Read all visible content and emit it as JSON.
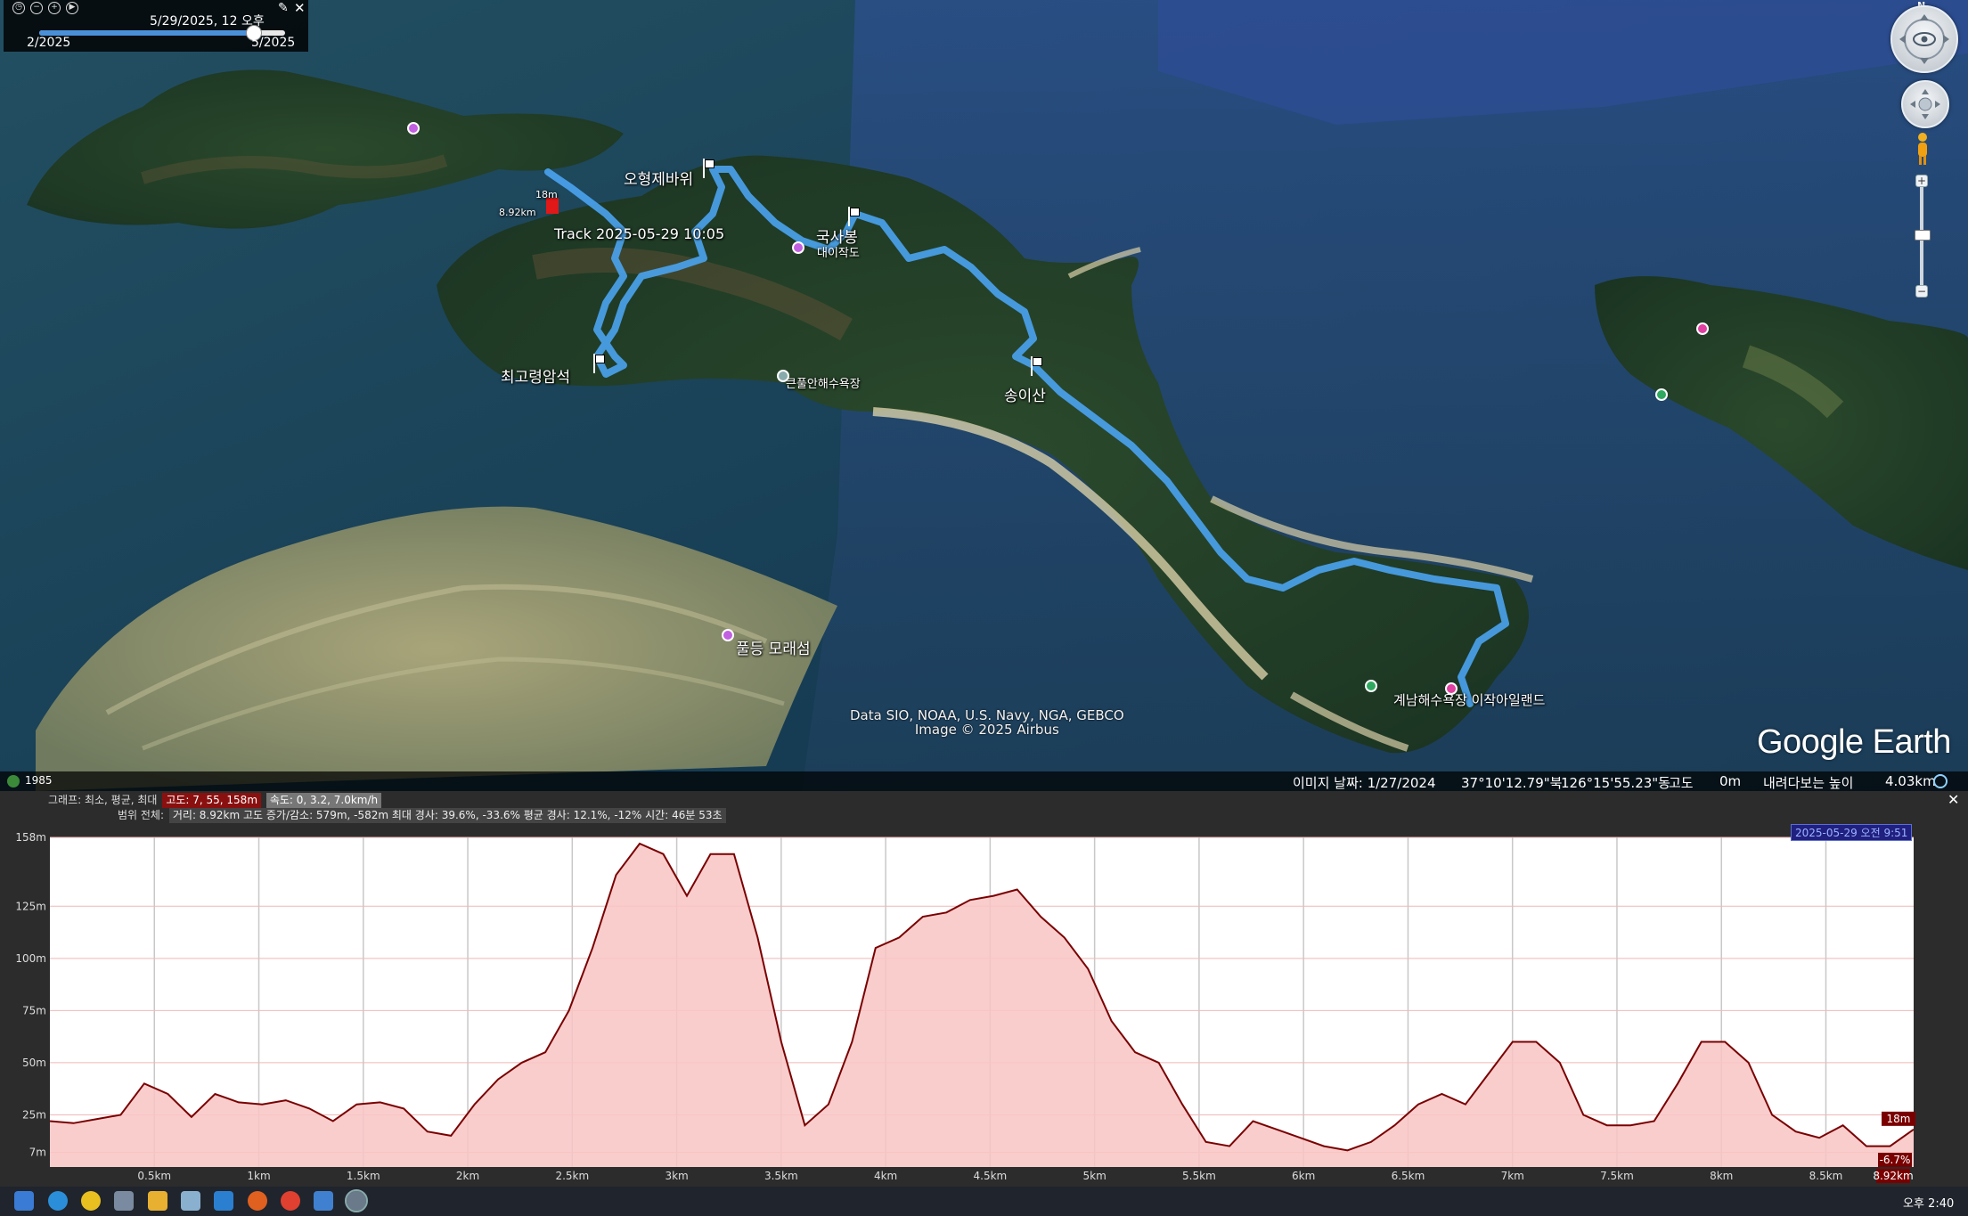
{
  "time_slider": {
    "current": "5/29/2025, 12 오후",
    "start": "2/2025",
    "end": "5/2025",
    "position_fraction": 0.87
  },
  "map": {
    "place_labels": [
      "오형제바위",
      "최고령암석",
      "송이산",
      "국사봉"
    ],
    "poi_labels": [
      "대이작도",
      "큰풀안해수욕장",
      "풀등 모래섬",
      "계남해수욕장 이작아일랜드"
    ],
    "track_label": "Track 2025-05-29 10:05",
    "track_start_alt": "18m",
    "track_start_dist": "8.92km",
    "track_color": "#4aa3f0",
    "attribution_line1": "Data SIO, NOAA, U.S. Navy, NGA, GEBCO",
    "attribution_line2": "Image © 2025 Airbus",
    "logo": "Google Earth"
  },
  "status": {
    "year": "1985",
    "image_date": "이미지 날짜: 1/27/2024",
    "lat": "37°10'12.79\"북",
    "lon": "126°15'55.23\"동",
    "alt_label": "고도",
    "alt_value": "0m",
    "eye_alt_label": "내려다보는 높이",
    "eye_alt_value": "4.03km"
  },
  "profile": {
    "row1_label": "그래프: 최소, 평균, 최대",
    "row1_alt": "고도: 7, 55, 158m",
    "row1_speed": "속도: 0, 3.2, 7.0km/h",
    "row2_label": "범위 전체:",
    "row2_values": "거리: 8.92km  고도 증가/감소: 579m, -582m  최대 경사: 39.6%, -33.6%  평균 경사: 12.1%, -12%  시간: 46분 53초",
    "date_badge": "2025-05-29 오전 9:51",
    "current_alt": "18m",
    "current_slope": "-6.7%",
    "current_dist": "8.92km",
    "fill_color": "#f9c4c4",
    "line_color": "#7a0000"
  },
  "chart_data": {
    "type": "area",
    "title": "",
    "xlabel": "",
    "ylabel": "",
    "x_unit": "km",
    "y_unit": "m",
    "xlim": [
      0,
      8.92
    ],
    "ylim": [
      0,
      158
    ],
    "x_ticks": [
      "0.5km",
      "1km",
      "1.5km",
      "2km",
      "2.5km",
      "3km",
      "3.5km",
      "4km",
      "4.5km",
      "5km",
      "5.5km",
      "6km",
      "6.5km",
      "7km",
      "7.5km",
      "8km",
      "8.5km"
    ],
    "y_ticks": [
      "158m",
      "125m",
      "100m",
      "75m",
      "50m",
      "25m",
      "7m"
    ],
    "x": [
      0,
      0.1,
      0.2,
      0.3,
      0.4,
      0.5,
      0.6,
      0.7,
      0.8,
      0.9,
      1.0,
      1.1,
      1.2,
      1.3,
      1.4,
      1.5,
      1.6,
      1.7,
      1.8,
      1.9,
      2.0,
      2.1,
      2.2,
      2.3,
      2.4,
      2.5,
      2.6,
      2.7,
      2.8,
      2.9,
      3.0,
      3.1,
      3.2,
      3.3,
      3.4,
      3.5,
      3.6,
      3.7,
      3.8,
      3.9,
      4.0,
      4.1,
      4.2,
      4.3,
      4.4,
      4.5,
      4.6,
      4.7,
      4.8,
      4.9,
      5.0,
      5.1,
      5.2,
      5.3,
      5.4,
      5.5,
      5.6,
      5.7,
      5.8,
      5.9,
      6.0,
      6.1,
      6.2,
      6.3,
      6.4,
      6.5,
      6.6,
      6.7,
      6.8,
      6.9,
      7.0,
      7.1,
      7.2,
      7.3,
      7.4,
      7.5,
      7.6,
      7.7,
      7.8,
      7.9,
      8.0,
      8.1,
      8.2,
      8.3,
      8.4,
      8.5,
      8.6,
      8.7,
      8.8,
      8.92
    ],
    "series": [
      {
        "values": [
          22,
          21,
          23,
          25,
          40,
          35,
          24,
          35,
          31,
          30,
          32,
          28,
          22,
          30,
          31,
          28,
          17,
          15,
          30,
          42,
          50,
          55,
          75,
          105,
          140,
          155,
          150,
          130,
          150,
          150,
          110,
          60,
          20,
          30,
          60,
          105,
          110,
          120,
          122,
          128,
          130,
          133,
          120,
          110,
          95,
          70,
          55,
          50,
          30,
          12,
          10,
          22,
          18,
          14,
          10,
          8,
          12,
          20,
          30,
          35,
          30,
          45,
          60,
          60,
          50,
          25,
          20,
          20,
          22,
          40,
          60,
          60,
          50,
          25,
          17,
          14,
          20,
          10,
          10,
          18
        ]
      }
    ]
  },
  "taskbar": {
    "clock": "오후 2:40",
    "apps": [
      "windows-icon",
      "ie-icon",
      "media-icon",
      "app-icon",
      "explorer-icon",
      "notepad-icon",
      "vscode-icon",
      "firefox-icon",
      "chrome-icon",
      "tool-icon",
      "google-earth-icon"
    ]
  }
}
